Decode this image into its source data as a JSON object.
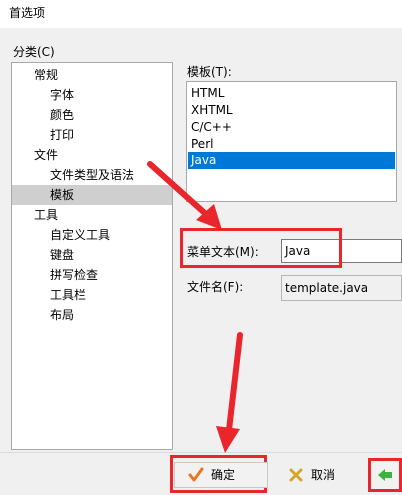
{
  "window": {
    "title": "首选项"
  },
  "categories": {
    "label": "分类(C)",
    "items": [
      {
        "label": "常规",
        "level": 0
      },
      {
        "label": "字体",
        "level": 1
      },
      {
        "label": "颜色",
        "level": 1
      },
      {
        "label": "打印",
        "level": 1
      },
      {
        "label": "文件",
        "level": 0
      },
      {
        "label": "文件类型及语法",
        "level": 1
      },
      {
        "label": "模板",
        "level": 1,
        "selected": true
      },
      {
        "label": "工具",
        "level": 0
      },
      {
        "label": "自定义工具",
        "level": 1
      },
      {
        "label": "键盘",
        "level": 1
      },
      {
        "label": "拼写检查",
        "level": 1
      },
      {
        "label": "工具栏",
        "level": 1
      },
      {
        "label": "布局",
        "level": 1
      }
    ]
  },
  "templates": {
    "label": "模板(T):",
    "items": [
      {
        "label": "HTML"
      },
      {
        "label": "XHTML"
      },
      {
        "label": "C/C++"
      },
      {
        "label": "Perl"
      },
      {
        "label": "Java",
        "selected": true
      }
    ]
  },
  "menu_text": {
    "label": "菜单文本(M):",
    "value": "Java"
  },
  "filename": {
    "label": "文件名(F):",
    "value": "template.java"
  },
  "buttons": {
    "ok": "确定",
    "cancel": "取消"
  },
  "colors": {
    "selection": "#0078d7",
    "annotation": "#e8262b",
    "ok_check": "#e87722",
    "cancel_x": "#d4a52a",
    "apply_arrow": "#3db33d"
  },
  "icons": {
    "ok": "checkmark-icon",
    "cancel": "x-icon",
    "apply": "arrow-left-icon"
  }
}
